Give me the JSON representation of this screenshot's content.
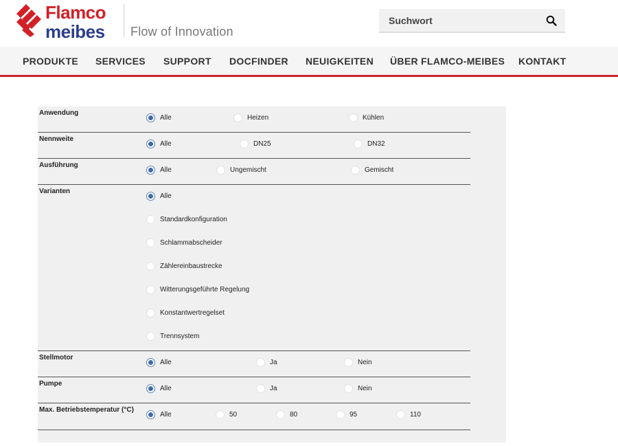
{
  "header": {
    "brand_line1": "Flamco",
    "brand_line2": "meibes",
    "tagline": "Flow of Innovation",
    "search_placeholder": "Suchwort"
  },
  "colors": {
    "brand_red": "#d22027",
    "brand_blue": "#2c3e8c",
    "radio_checked": "#3e6aad",
    "nav_underline": "#c9242b"
  },
  "nav": {
    "items": [
      "PRODUKTE",
      "SERVICES",
      "SUPPORT",
      "DOCFINDER",
      "NEUIGKEITEN",
      "ÜBER FLAMCO-MEIBES",
      "KONTAKT"
    ]
  },
  "filters": [
    {
      "label": "Anwendung",
      "options": [
        "Alle",
        "Heizen",
        "Kühlen"
      ],
      "selected": 0
    },
    {
      "label": "Nennweite",
      "options": [
        "Alle",
        "DN25",
        "DN32"
      ],
      "selected": 0
    },
    {
      "label": "Ausführung",
      "options": [
        "Alle",
        "Ungemischt",
        "Gemischt"
      ],
      "selected": 0
    },
    {
      "label": "Varianten",
      "options": [
        "Alle",
        "Standardkonfiguration",
        "Schlammabscheider",
        "Zählereinbaustrecke",
        "Witterungsgeführte Regelung",
        "Konstantwertregelset",
        "Trennsystem"
      ],
      "selected": 0
    },
    {
      "label": "Stellmotor",
      "options": [
        "Alle",
        "Ja",
        "Nein"
      ],
      "selected": 0
    },
    {
      "label": "Pumpe",
      "options": [
        "Alle",
        "Ja",
        "Nein"
      ],
      "selected": 0
    },
    {
      "label": "Max. Betriebstemperatur (°C)",
      "options": [
        "Alle",
        "50",
        "80",
        "95",
        "110"
      ],
      "selected": 0
    }
  ]
}
